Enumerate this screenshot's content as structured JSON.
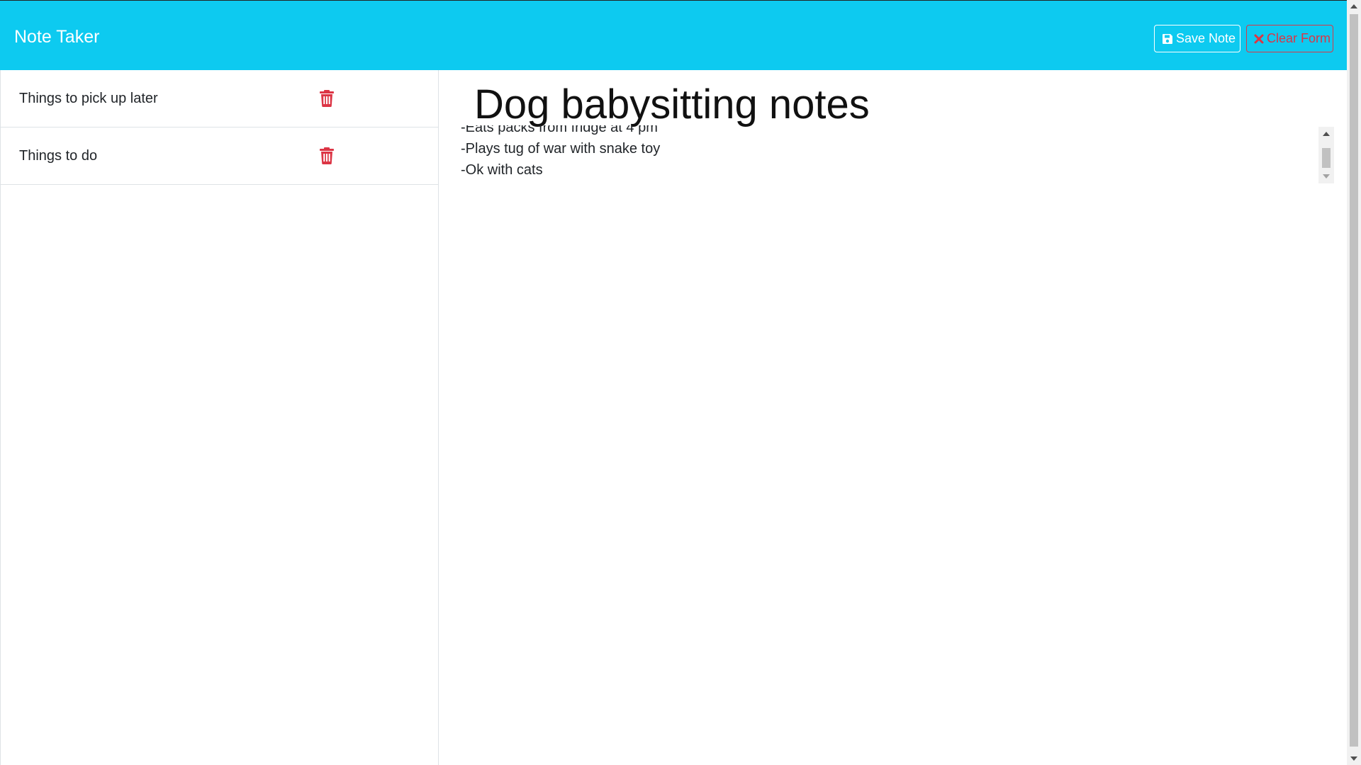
{
  "app": {
    "title": "Note Taker"
  },
  "toolbar": {
    "save_label": "Save Note",
    "clear_label": "Clear Form"
  },
  "notes": [
    {
      "title": "Things to pick up later"
    },
    {
      "title": "Things to do"
    }
  ],
  "editor": {
    "title_value": "Dog babysitting notes",
    "body_lines": [
      "-Eats packs from fridge at 4 pm",
      "-Plays tug of war with snake toy",
      "-Ok with cats"
    ]
  },
  "colors": {
    "navbar_bg": "#0dcaf0",
    "danger": "#dc3545",
    "text": "#212529"
  },
  "icons": {
    "save": "floppy-disk-icon",
    "clear": "x-icon",
    "delete": "trash-icon"
  }
}
